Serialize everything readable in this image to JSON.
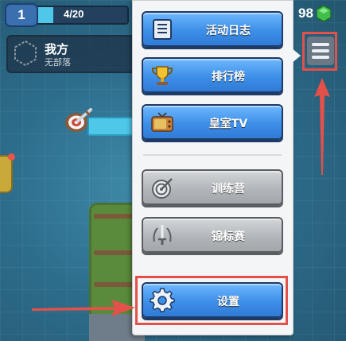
{
  "hud": {
    "level": "1",
    "xp_text": "4/20",
    "xp_fraction": 0.2,
    "gems": "98"
  },
  "clan": {
    "name": "我方",
    "status": "无部落"
  },
  "menu": {
    "items": [
      {
        "label": "活动日志",
        "style": "blue",
        "icon": "scroll-icon"
      },
      {
        "label": "排行榜",
        "style": "blue",
        "icon": "trophy-icon"
      },
      {
        "label": "皇室TV",
        "style": "blue",
        "icon": "tv-icon"
      },
      {
        "label": "训练营",
        "style": "gray",
        "icon": "training-target-icon"
      },
      {
        "label": "锦标赛",
        "style": "gray",
        "icon": "tournament-sword-icon"
      },
      {
        "label": "设置",
        "style": "blue",
        "icon": "gear-icon"
      }
    ]
  },
  "annotations": {
    "color": "#e4504a"
  },
  "colors": {
    "blue_button": "#3e8fe8",
    "gray_button": "#b0b4b8",
    "gem_green": "#3fbf4a"
  }
}
